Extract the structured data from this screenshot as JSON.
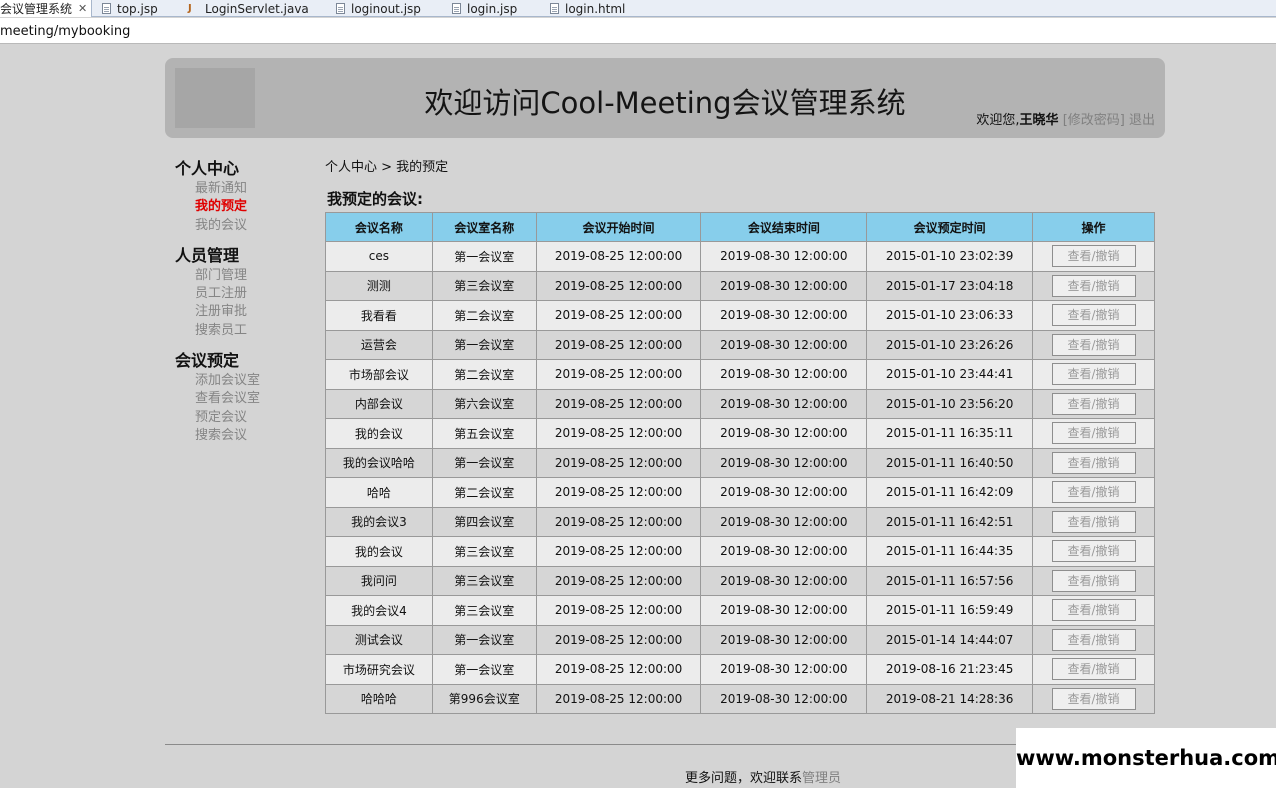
{
  "tabs": [
    {
      "label": "会议管理系统",
      "icon": "none",
      "active": true
    },
    {
      "label": "top.jsp",
      "icon": "file-icon"
    },
    {
      "label": "LoginServlet.java",
      "icon": "java-file-icon"
    },
    {
      "label": "loginout.jsp",
      "icon": "file-icon"
    },
    {
      "label": "login.jsp",
      "icon": "file-icon"
    },
    {
      "label": "login.html",
      "icon": "file-icon"
    }
  ],
  "tab_close_glyph": "✕",
  "address": "meeting/mybooking",
  "header": {
    "title": "欢迎访问Cool-Meeting会议管理系统",
    "welcome_prefix": "欢迎您,",
    "username": "王晓华",
    "change_password": "[修改密码]",
    "logout": "退出"
  },
  "sidebar": [
    {
      "title": "个人中心",
      "items": [
        "最新通知",
        "我的预定",
        "我的会议"
      ]
    },
    {
      "title": "人员管理",
      "items": [
        "部门管理",
        "员工注册",
        "注册审批",
        "搜索员工"
      ]
    },
    {
      "title": "会议预定",
      "items": [
        "添加会议室",
        "查看会议室",
        "预定会议",
        "搜索会议"
      ]
    }
  ],
  "breadcrumb": "个人中心 > 我的预定",
  "section_title": "我预定的会议:",
  "table": {
    "headers": [
      "会议名称",
      "会议室名称",
      "会议开始时间",
      "会议结束时间",
      "会议预定时间",
      "操作"
    ],
    "action_label": "查看/撤销",
    "rows": [
      [
        "ces",
        "第一会议室",
        "2019-08-25 12:00:00",
        "2019-08-30 12:00:00",
        "2015-01-10 23:02:39"
      ],
      [
        "测测",
        "第三会议室",
        "2019-08-25 12:00:00",
        "2019-08-30 12:00:00",
        "2015-01-17 23:04:18"
      ],
      [
        "我看看",
        "第二会议室",
        "2019-08-25 12:00:00",
        "2019-08-30 12:00:00",
        "2015-01-10 23:06:33"
      ],
      [
        "运营会",
        "第一会议室",
        "2019-08-25 12:00:00",
        "2019-08-30 12:00:00",
        "2015-01-10 23:26:26"
      ],
      [
        "市场部会议",
        "第二会议室",
        "2019-08-25 12:00:00",
        "2019-08-30 12:00:00",
        "2015-01-10 23:44:41"
      ],
      [
        "内部会议",
        "第六会议室",
        "2019-08-25 12:00:00",
        "2019-08-30 12:00:00",
        "2015-01-10 23:56:20"
      ],
      [
        "我的会议",
        "第五会议室",
        "2019-08-25 12:00:00",
        "2019-08-30 12:00:00",
        "2015-01-11 16:35:11"
      ],
      [
        "我的会议哈哈",
        "第一会议室",
        "2019-08-25 12:00:00",
        "2019-08-30 12:00:00",
        "2015-01-11 16:40:50"
      ],
      [
        "哈哈",
        "第二会议室",
        "2019-08-25 12:00:00",
        "2019-08-30 12:00:00",
        "2015-01-11 16:42:09"
      ],
      [
        "我的会议3",
        "第四会议室",
        "2019-08-25 12:00:00",
        "2019-08-30 12:00:00",
        "2015-01-11 16:42:51"
      ],
      [
        "我的会议",
        "第三会议室",
        "2019-08-25 12:00:00",
        "2019-08-30 12:00:00",
        "2015-01-11 16:44:35"
      ],
      [
        "我问问",
        "第三会议室",
        "2019-08-25 12:00:00",
        "2019-08-30 12:00:00",
        "2015-01-11 16:57:56"
      ],
      [
        "我的会议4",
        "第三会议室",
        "2019-08-25 12:00:00",
        "2019-08-30 12:00:00",
        "2015-01-11 16:59:49"
      ],
      [
        "测试会议",
        "第一会议室",
        "2019-08-25 12:00:00",
        "2019-08-30 12:00:00",
        "2015-01-14 14:44:07"
      ],
      [
        "市场研究会议",
        "第一会议室",
        "2019-08-25 12:00:00",
        "2019-08-30 12:00:00",
        "2019-08-16 21:23:45"
      ],
      [
        "哈哈哈",
        "第996会议室",
        "2019-08-25 12:00:00",
        "2019-08-30 12:00:00",
        "2019-08-21 14:28:36"
      ]
    ]
  },
  "footer": {
    "text": "更多问题，欢迎联系",
    "link": "管理员"
  },
  "watermark": "www.monsterhua.com",
  "colors": {
    "header_bg": "#b3b3b3",
    "table_header_bg": "#87ceeb",
    "current_menu": "#e00000",
    "link_gray": "#808080"
  }
}
